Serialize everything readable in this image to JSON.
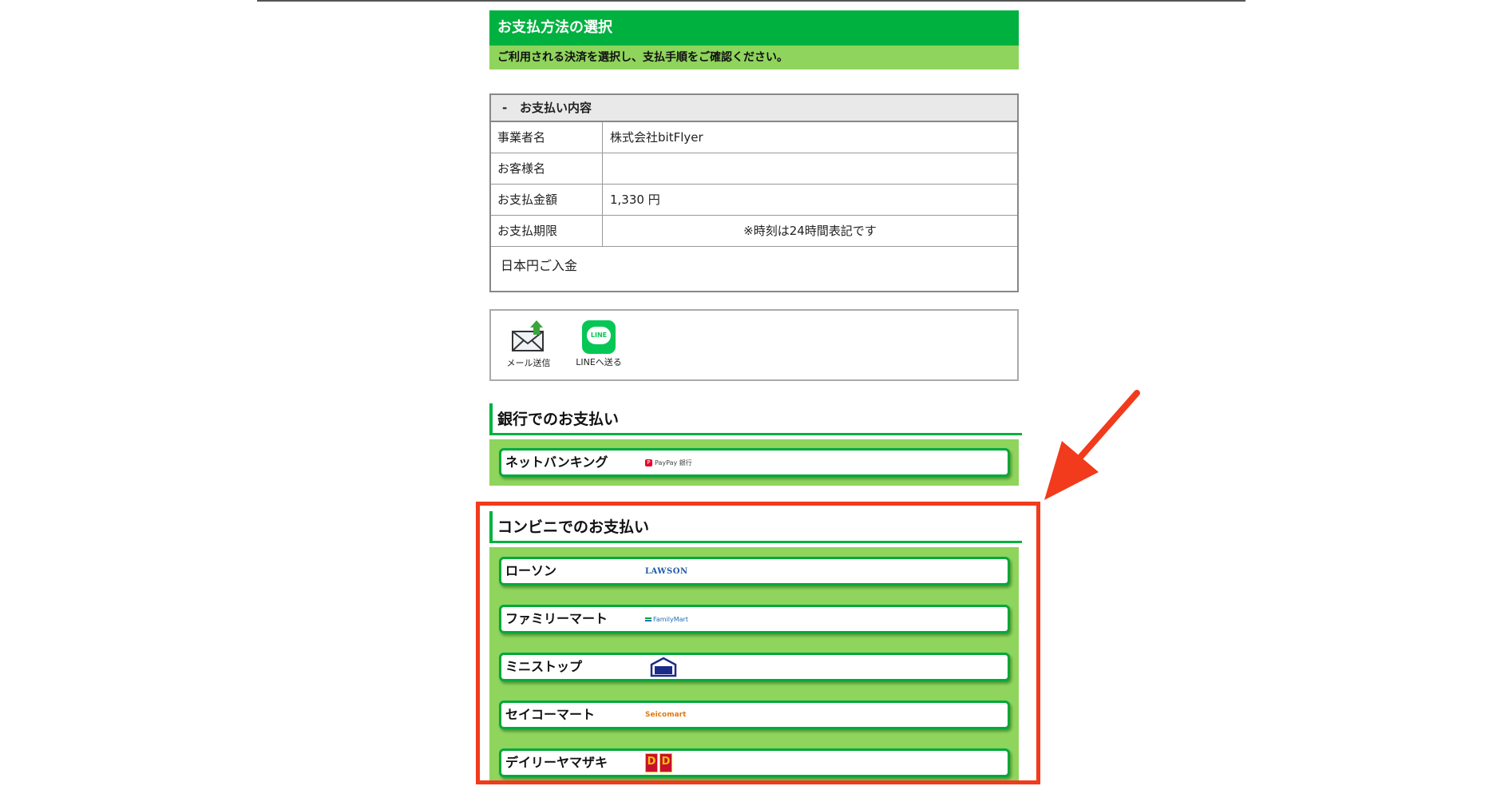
{
  "header": {
    "title": "お支払方法の選択",
    "subtitle": "ご利用される決済を選択し、支払手順をご確認ください。"
  },
  "details": {
    "toggle": "-",
    "heading": "お支払い内容",
    "rows": [
      {
        "label": "事業者名",
        "value": "株式会社bitFlyer"
      },
      {
        "label": "お客様名",
        "value": ""
      },
      {
        "label": "お支払金額",
        "value": "1,330 円"
      },
      {
        "label": "お支払期限",
        "value": "※時刻は24時間表記です"
      }
    ],
    "note": "日本円ご入金"
  },
  "share": {
    "mail_label": "メール送信",
    "line_label": "LINEへ送る",
    "line_logo_text": "LINE"
  },
  "bank_section": {
    "title": "銀行でのお支払い",
    "items": [
      {
        "label": "ネットバンキング",
        "logo_text": "PayPay 銀行"
      }
    ]
  },
  "convenience_section": {
    "title": "コンビニでのお支払い",
    "items": [
      {
        "label": "ローソン",
        "logo_text": "LAWSON"
      },
      {
        "label": "ファミリーマート",
        "logo_text": "FamilyMart"
      },
      {
        "label": "ミニストップ",
        "logo_text": "MINI STOP"
      },
      {
        "label": "セイコーマート",
        "logo_text": "Seicomart"
      },
      {
        "label": "デイリーヤマザキ",
        "logo_text": "D"
      }
    ]
  },
  "colors": {
    "primary_green": "#00b140",
    "light_green": "#8fd45c",
    "annotation_red": "#f23a1c",
    "line_green": "#06c755"
  }
}
